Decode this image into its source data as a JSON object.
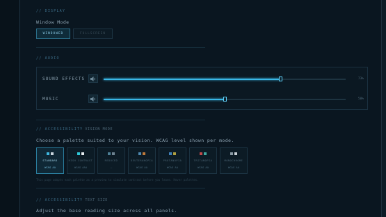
{
  "display": {
    "section_title": "// DISPLAY",
    "window_mode_label": "Window Mode",
    "modes": [
      "WINDOWED",
      "FULLSCREEN"
    ]
  },
  "audio": {
    "section_title": "// AUDIO",
    "channels": [
      {
        "name": "SOUND EFFECTS",
        "value": 73,
        "value_label": "73%"
      },
      {
        "name": "MUSIC",
        "value": 50,
        "value_label": "50%"
      }
    ]
  },
  "accessibility": {
    "section_title": "// ACCESSIBILITY",
    "section_sub": "Vision Mode",
    "description": "Choose a palette suited to your vision. WCAG level shown per mode.",
    "palettes": [
      {
        "name": "STANDARD",
        "level": "WCAG AA",
        "swatches": [
          "#3fb8e0",
          "#c9d6de"
        ],
        "selected": true
      },
      {
        "name": "HIGH CONTRAST",
        "level": "WCAG AAA",
        "swatches": [
          "#2fc8d8",
          "#e6ecef"
        ]
      },
      {
        "name": "REDUCED",
        "level": "—",
        "swatches": [
          "#4d7f95",
          "#6d8290"
        ]
      },
      {
        "name": "DEUTERANOPIA",
        "level": "WCAG AA",
        "swatches": [
          "#4d88b0",
          "#c07a3a"
        ]
      },
      {
        "name": "PROTANOPIA",
        "level": "WCAG AA",
        "swatches": [
          "#3f7fb8",
          "#b0a040"
        ]
      },
      {
        "name": "TRITANOPIA",
        "level": "WCAG AA",
        "swatches": [
          "#c04a4a",
          "#3fa8a0"
        ]
      },
      {
        "name": "MONOCHROME",
        "level": "WCAG AA",
        "swatches": [
          "#8a9aa4",
          "#c8d0d6"
        ]
      }
    ],
    "hint": "This page adopts each palette as a preview to simulate contrast before you leave. Hover palettes."
  },
  "text_size": {
    "section_title": "// ACCESSIBILITY",
    "section_sub": "Text Size",
    "description": "Adjust the base reading size across all panels."
  }
}
